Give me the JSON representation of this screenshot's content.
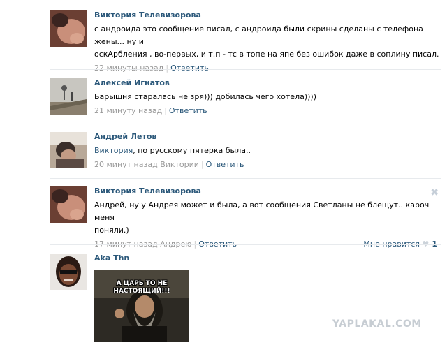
{
  "comments": [
    {
      "author": "Виктория Телевизорова",
      "text_line1": "с андроида это сообщение писал, с андроида были скрины сделаны с телефона жены... ну и",
      "text_line2": "оскАрбления , во-первых, и т.п - тс в топе на япе без ошибок даже в соплину писал.",
      "time": "22 минуты назад",
      "reply": "Ответить"
    },
    {
      "author": "Алексей Игнатов",
      "text": "Барышня старалась не зря))) добилась чего хотела))))",
      "time": "21 минуту назад",
      "reply": "Ответить"
    },
    {
      "author": "Андрей Летов",
      "text_link": "Виктория",
      "text": ", по русскому пятерка была..",
      "time": "20 минут назад",
      "addressee": "Виктории",
      "reply": "Ответить"
    },
    {
      "author": "Виктория Телевизорова",
      "text_line1": "Андрей, ну у Андрея может и была, а вот сообщения Светланы не блещут.. кароч меня",
      "text_line2": "поняли.)",
      "time": "17 минут назад",
      "addressee": "Андрею",
      "reply": "Ответить",
      "like_label": "Мне нравится",
      "like_count": "1",
      "close_glyph": "✖"
    },
    {
      "author": "Aka Thn",
      "meme_caption_line1": "А ЦАРЬ ТО НЕ",
      "meme_caption_line2": "НАСТОЯЩИЙ!!!"
    }
  ],
  "watermark": "YAPLAKAL.COM",
  "colors": {
    "link": "#2b587a",
    "meta": "#999999",
    "divider": "#e7eaed",
    "watermark": "#c7cdd3"
  }
}
